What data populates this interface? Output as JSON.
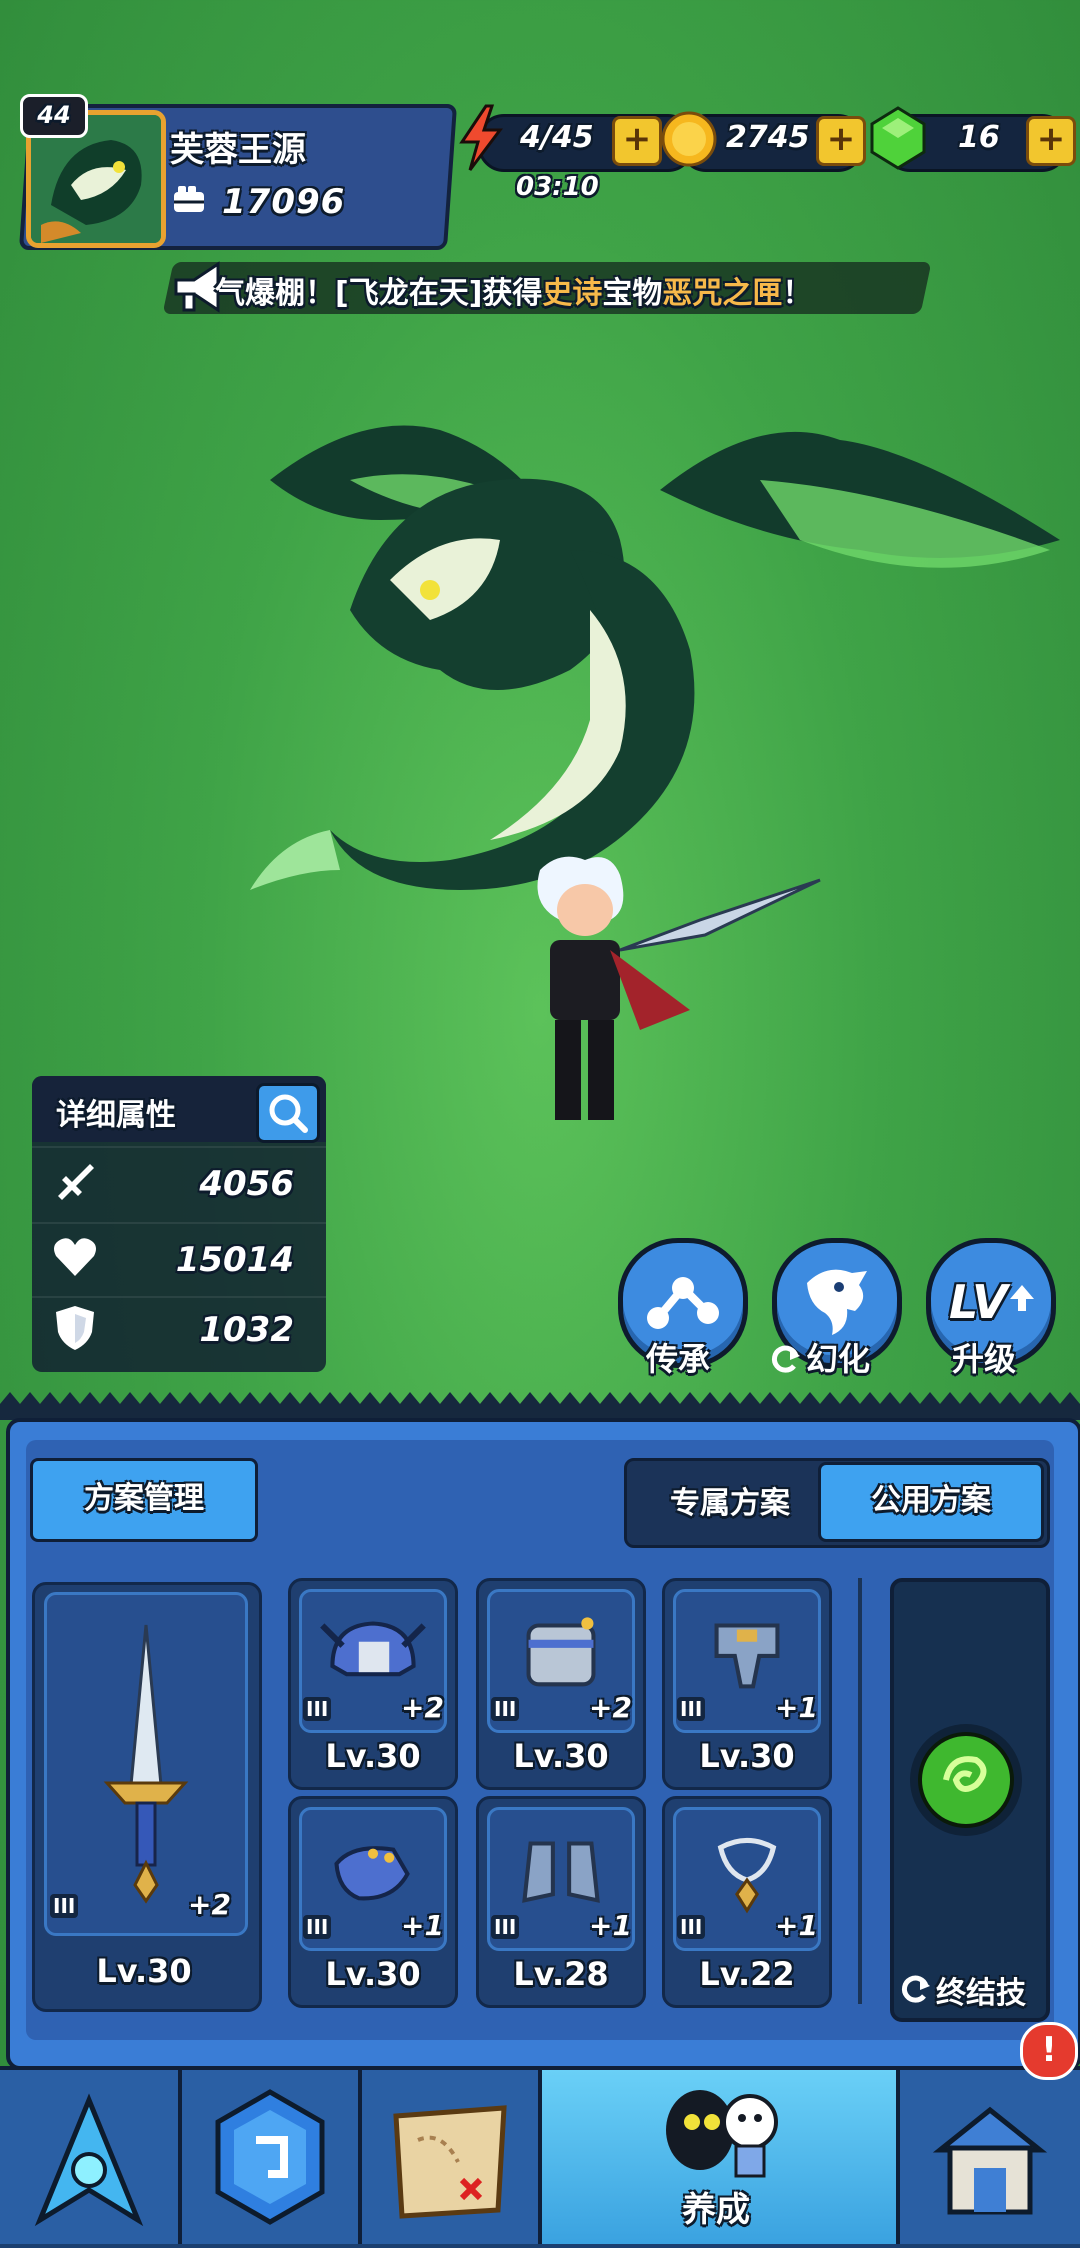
{
  "header": {
    "level": "44",
    "player_name": "芙蓉王源",
    "power": "17096",
    "energy": "4/45",
    "energy_timer": "03:10",
    "gold": "2745",
    "gems": "16",
    "plus_label": "+"
  },
  "news": {
    "prefix": "气爆棚！[飞龙在天]获得",
    "rarity": "史诗",
    "middle": "宝物",
    "item": "恶咒之匣",
    "suffix": "！"
  },
  "stats": {
    "title": "详细属性",
    "attack": "4056",
    "hp": "15014",
    "defense": "1032"
  },
  "actions": {
    "inherit": "传承",
    "transform": "幻化",
    "upgrade": "升级",
    "upgrade_icon_text": "LV"
  },
  "panel": {
    "plan_manage": "方案管理",
    "tab_exclusive": "专属方案",
    "tab_public": "公用方案",
    "ultimate": "终结技",
    "rank_label": "III",
    "weapon": {
      "plus": "+2",
      "level": "Lv.30"
    },
    "slots": [
      {
        "plus": "+2",
        "level": "Lv.30"
      },
      {
        "plus": "+2",
        "level": "Lv.30"
      },
      {
        "plus": "+1",
        "level": "Lv.30"
      },
      {
        "plus": "+1",
        "level": "Lv.30"
      },
      {
        "plus": "+1",
        "level": "Lv.28"
      },
      {
        "plus": "+1",
        "level": "Lv.22"
      }
    ]
  },
  "nav": {
    "active_label": "养成",
    "alert": "!"
  }
}
